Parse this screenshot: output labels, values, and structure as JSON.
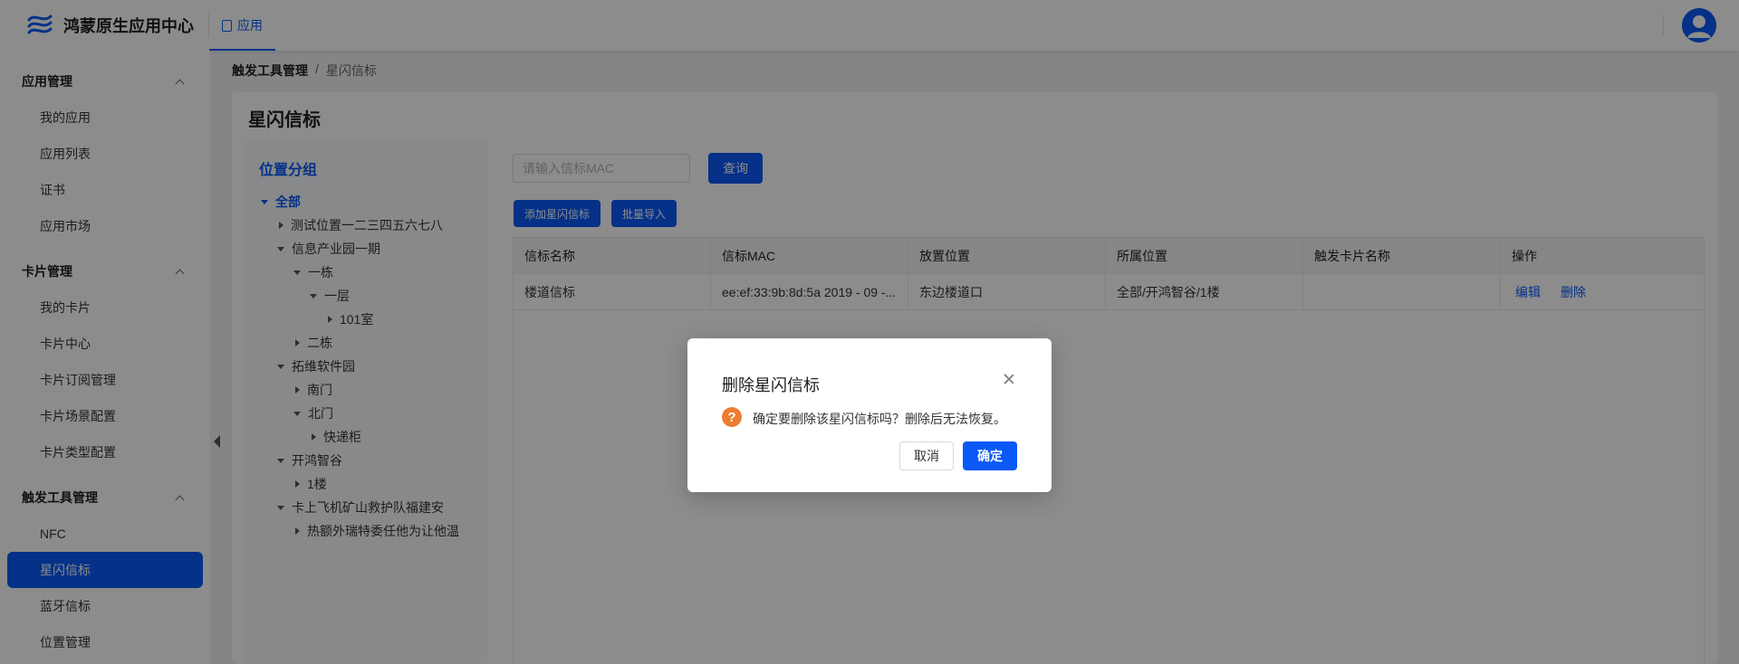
{
  "header": {
    "logo_text": "鸿蒙原生应用中心",
    "tab_label": "应用",
    "logo_color": "#0a59f7"
  },
  "sidebar": {
    "groups": [
      {
        "title": "应用管理",
        "items": [
          "我的应用",
          "应用列表",
          "证书",
          "应用市场"
        ]
      },
      {
        "title": "卡片管理",
        "items": [
          "我的卡片",
          "卡片中心",
          "卡片订阅管理",
          "卡片场景配置",
          "卡片类型配置"
        ]
      },
      {
        "title": "触发工具管理",
        "items": [
          "NFC",
          "星闪信标",
          "蓝牙信标",
          "位置管理"
        ]
      }
    ],
    "active_item": "星闪信标"
  },
  "breadcrumb": {
    "parent": "触发工具管理",
    "separator": "/",
    "current": "星闪信标"
  },
  "page": {
    "title": "星闪信标"
  },
  "tree": {
    "title": "位置分组",
    "nodes": [
      {
        "label": "全部",
        "expanded": true
      },
      {
        "label": "测试位置一二三四五六七八",
        "expanded": false
      },
      {
        "label": "信息产业园一期",
        "expanded": true
      },
      {
        "label": "一栋",
        "expanded": true
      },
      {
        "label": "一层",
        "expanded": true
      },
      {
        "label": "101室",
        "expanded": false
      },
      {
        "label": "二栋",
        "expanded": false
      },
      {
        "label": "拓维软件园",
        "expanded": true
      },
      {
        "label": "南门",
        "expanded": false
      },
      {
        "label": "北门",
        "expanded": true
      },
      {
        "label": "快递柜",
        "expanded": false
      },
      {
        "label": "开鸿智谷",
        "expanded": true
      },
      {
        "label": "1楼",
        "expanded": false
      },
      {
        "label": "卡上飞机矿山救护队福建安",
        "expanded": true
      },
      {
        "label": "热额外瑞特委任他为让他温",
        "expanded": false
      }
    ]
  },
  "search": {
    "placeholder": "请输入信标MAC",
    "value": "",
    "query_label": "查询"
  },
  "toolbar": {
    "add_label": "添加星闪信标",
    "import_label": "批量导入"
  },
  "table": {
    "columns": [
      "信标名称",
      "信标MAC",
      "放置位置",
      "所属位置",
      "触发卡片名称",
      "操作"
    ],
    "rows": [
      {
        "name": "楼道信标",
        "mac": "ee:ef:33:9b:8d:5a  2019 - 09 -...",
        "placement": "东边楼道口",
        "location": "全部/开鸿智谷/1楼",
        "card": "",
        "edit_label": "编辑",
        "delete_label": "删除"
      }
    ]
  },
  "modal": {
    "title": "删除星闪信标",
    "icon": "?",
    "message": "确定要删除该星闪信标吗？删除后无法恢复。",
    "cancel_label": "取消",
    "confirm_label": "确定"
  }
}
